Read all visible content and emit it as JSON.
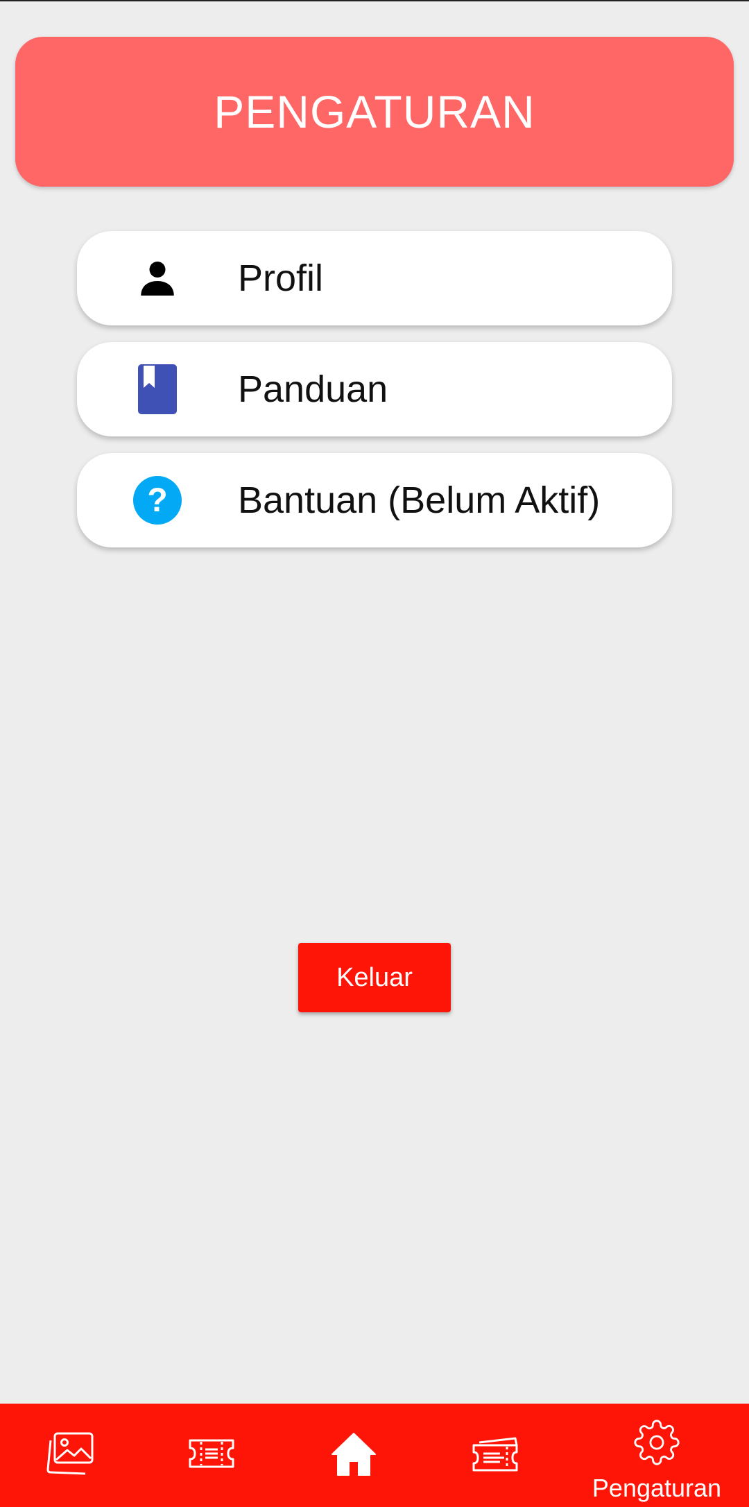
{
  "header": {
    "title": "PENGATURAN"
  },
  "menu": {
    "items": [
      {
        "label": "Profil",
        "icon": "person-icon"
      },
      {
        "label": "Panduan",
        "icon": "book-icon"
      },
      {
        "label": "Bantuan (Belum Aktif)",
        "icon": "help-icon"
      }
    ]
  },
  "logout": {
    "label": "Keluar"
  },
  "bottom_nav": {
    "items": [
      {
        "icon": "gallery-icon"
      },
      {
        "icon": "ticket-icon"
      },
      {
        "icon": "home-icon"
      },
      {
        "icon": "tickets-icon"
      },
      {
        "icon": "gear-icon",
        "label": "Pengaturan",
        "active": true
      }
    ]
  },
  "colors": {
    "background": "#ededed",
    "header": "#ff6666",
    "accent_red": "#ff1408",
    "book_blue": "#3f51b5",
    "help_blue": "#03a9f4"
  }
}
